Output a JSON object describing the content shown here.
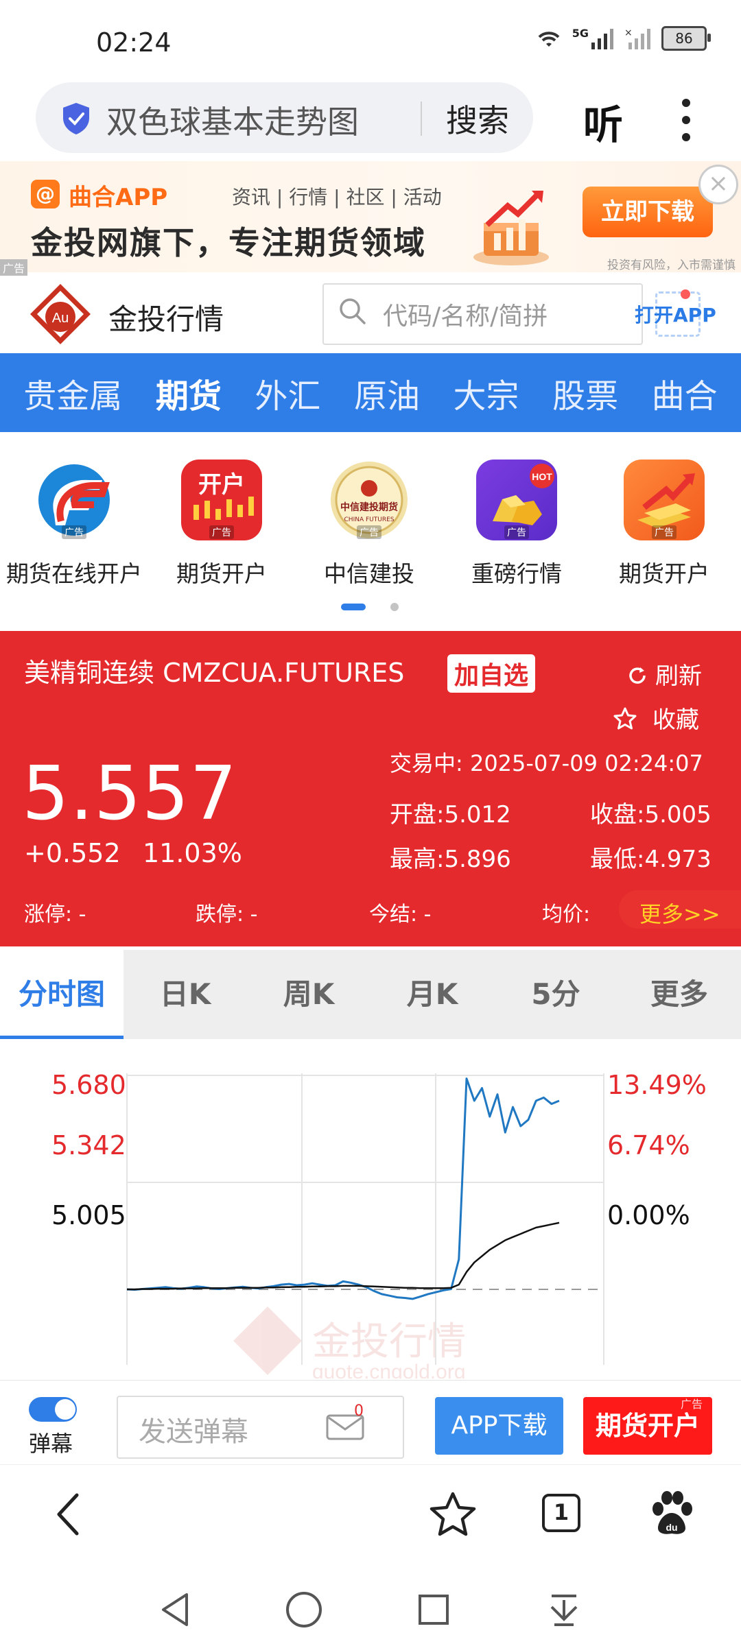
{
  "status_bar": {
    "time": "02:24",
    "network": "5G",
    "battery": "86"
  },
  "browser": {
    "query": "双色球基本走势图",
    "search_label": "搜索",
    "listen_label": "听"
  },
  "ad_banner": {
    "logo_char": "@",
    "app_name": "曲合APP",
    "tags": "资讯 | 行情 | 社区 | 活动",
    "headline": "金投网旗下，专注期货领域",
    "download_label": "立即下载",
    "close": "×",
    "risk": "投资有风险，入市需谨慎",
    "ad_label": "广告"
  },
  "site": {
    "name": "金投行情",
    "logo_text": "Au",
    "search_placeholder": "代码/名称/简拼",
    "open_app": "打开APP"
  },
  "nav": {
    "items": [
      "贵金属",
      "期货",
      "外汇",
      "原油",
      "大宗",
      "股票",
      "曲合"
    ],
    "active": "期货"
  },
  "promos": [
    {
      "label": "期货在线开户",
      "icon": "F-logo-icon",
      "ad": "广告"
    },
    {
      "label": "期货开户",
      "icon": "candlestick-open-account-icon",
      "ad": "广告",
      "icon_text": "开户"
    },
    {
      "label": "中信建投",
      "icon": "citic-futures-seal-icon",
      "ad": "广告",
      "icon_text": "中信建投期货",
      "icon_sub": "CHINA FUTURES"
    },
    {
      "label": "重磅行情",
      "icon": "gold-nuggets-hot-icon",
      "ad": "广告",
      "badge": "HOT"
    },
    {
      "label": "期货开户",
      "icon": "gold-bars-arrow-icon",
      "ad": "广告"
    }
  ],
  "quote": {
    "title": "美精铜连续 CMZCUA.FUTURES",
    "add_watch": "加自选",
    "refresh": "刷新",
    "favorite": "收藏",
    "status": "交易中:  2025-07-09 02:24:07",
    "price": "5.557",
    "change": "+0.552",
    "change_pct": "11.03%",
    "open": "开盘:5.012",
    "prev_close": "收盘:5.005",
    "high": "最高:5.896",
    "low": "最低:4.973",
    "limit_up": "涨停:  -",
    "limit_down": "跌停:  -",
    "settle": "今结:  -",
    "avg": "均价:",
    "more": "更多>>"
  },
  "chart_tabs": [
    "分时图",
    "日K",
    "周K",
    "月K",
    "5分",
    "更多"
  ],
  "chart_tab_active": "分时图",
  "chart_data": {
    "type": "line",
    "title": "",
    "y_left_ticks": [
      "5.680",
      "5.342",
      "5.005"
    ],
    "y_right_ticks": [
      "13.49%",
      "6.74%",
      "0.00%"
    ],
    "ylim": [
      5.005,
      5.68
    ],
    "baseline": 5.005,
    "series": [
      {
        "role": "price",
        "color": "#1f78c1",
        "values": [
          5.005,
          5.004,
          5.006,
          5.008,
          5.01,
          5.012,
          5.009,
          5.007,
          5.01,
          5.014,
          5.012,
          5.008,
          5.006,
          5.009,
          5.011,
          5.013,
          5.01,
          5.008,
          5.012,
          5.015,
          5.02,
          5.022,
          5.018,
          5.02,
          5.024,
          5.02,
          5.016,
          5.018,
          5.03,
          5.026,
          5.02,
          5.012,
          5.0,
          4.99,
          4.985,
          4.98,
          4.978,
          4.975,
          4.982,
          4.99,
          4.996,
          5.002,
          5.006,
          5.1,
          5.67,
          5.6,
          5.64,
          5.55,
          5.62,
          5.5,
          5.58,
          5.52,
          5.54,
          5.6,
          5.61,
          5.59,
          5.6
        ]
      },
      {
        "role": "average",
        "color": "#111111",
        "values": [
          5.005,
          5.005,
          5.006,
          5.006,
          5.007,
          5.007,
          5.007,
          5.008,
          5.008,
          5.008,
          5.009,
          5.009,
          5.009,
          5.009,
          5.01,
          5.01,
          5.01,
          5.01,
          5.011,
          5.011,
          5.012,
          5.012,
          5.013,
          5.013,
          5.014,
          5.014,
          5.015,
          5.015,
          5.016,
          5.016,
          5.016,
          5.015,
          5.014,
          5.013,
          5.012,
          5.011,
          5.01,
          5.01,
          5.009,
          5.009,
          5.009,
          5.009,
          5.01,
          5.02,
          5.06,
          5.09,
          5.11,
          5.13,
          5.145,
          5.16,
          5.17,
          5.18,
          5.19,
          5.2,
          5.205,
          5.21,
          5.215
        ]
      }
    ],
    "watermark": "金投行情",
    "watermark_sub": "quote.cngold.org"
  },
  "barrage": {
    "toggle_label": "弹幕",
    "placeholder": "发送弹幕",
    "count": "0",
    "app_download": "APP下载",
    "futures_open": "期货开户",
    "ad": "广告"
  },
  "bottom": {
    "tabs_count": "1"
  }
}
